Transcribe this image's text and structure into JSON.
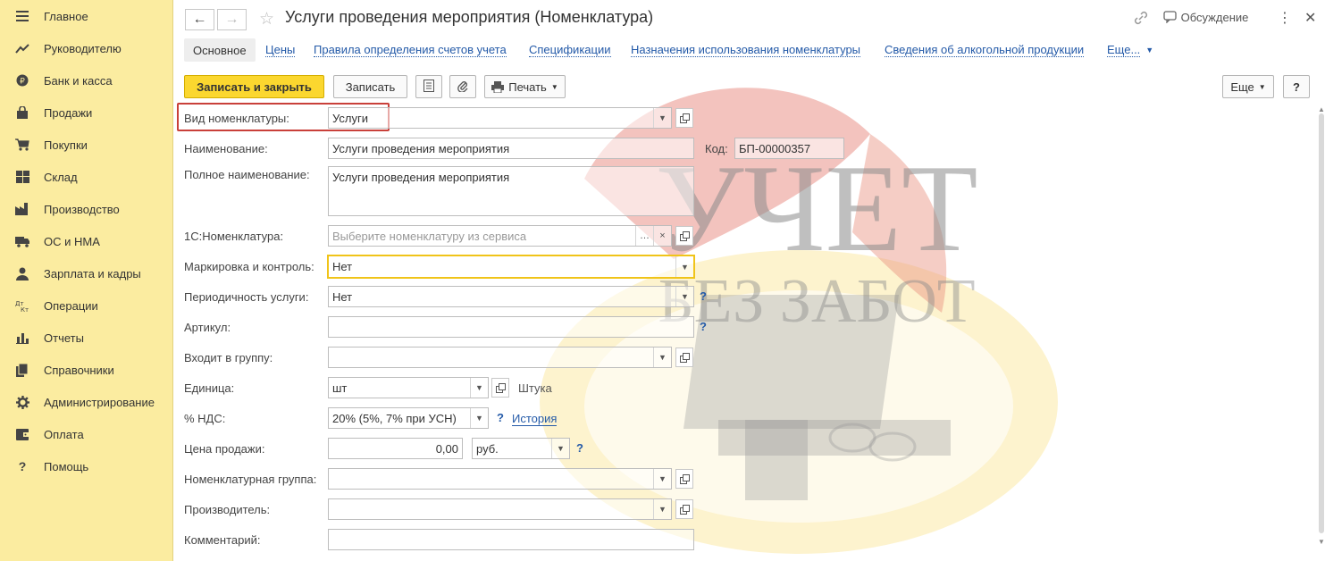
{
  "sidebar": {
    "items": [
      {
        "label": "Главное",
        "icon": "menu-icon"
      },
      {
        "label": "Руководителю",
        "icon": "trend-icon"
      },
      {
        "label": "Банк и касса",
        "icon": "coin-icon"
      },
      {
        "label": "Продажи",
        "icon": "bag-icon"
      },
      {
        "label": "Покупки",
        "icon": "cart-icon"
      },
      {
        "label": "Склад",
        "icon": "warehouse-icon"
      },
      {
        "label": "Производство",
        "icon": "factory-icon"
      },
      {
        "label": "ОС и НМА",
        "icon": "truck-icon"
      },
      {
        "label": "Зарплата и кадры",
        "icon": "person-icon"
      },
      {
        "label": "Операции",
        "icon": "dt-kt-icon"
      },
      {
        "label": "Отчеты",
        "icon": "bar-chart-icon"
      },
      {
        "label": "Справочники",
        "icon": "books-icon"
      },
      {
        "label": "Администрирование",
        "icon": "gear-icon"
      },
      {
        "label": "Оплата",
        "icon": "wallet-icon"
      },
      {
        "label": "Помощь",
        "icon": "question-icon"
      }
    ]
  },
  "header": {
    "title": "Услуги проведения мероприятия (Номенклатура)",
    "discussion_label": "Обсуждение"
  },
  "tabs": [
    {
      "label": "Основное"
    },
    {
      "label": "Цены"
    },
    {
      "label": "Правила определения счетов учета"
    },
    {
      "label": "Спецификации"
    },
    {
      "label": "Назначения использования номенклатуры"
    },
    {
      "label": "Сведения об алкогольной продукции"
    },
    {
      "label": "Еще..."
    }
  ],
  "toolbar": {
    "save_close_label": "Записать и закрыть",
    "save_label": "Записать",
    "print_label": "Печать",
    "more_label": "Еще",
    "help_label": "?"
  },
  "form": {
    "kind_label": "Вид номенклатуры:",
    "kind_value": "Услуги",
    "name_label": "Наименование:",
    "name_value": "Услуги проведения мероприятия",
    "code_label": "Код:",
    "code_value": "БП-00000357",
    "fullname_label": "Полное наименование:",
    "fullname_value": "Услуги проведения мероприятия",
    "nom1c_label": "1С:Номенклатура:",
    "nom1c_placeholder": "Выберите номенклатуру из сервиса",
    "marking_label": "Маркировка и контроль:",
    "marking_value": "Нет",
    "period_label": "Периодичность услуги:",
    "period_value": "Нет",
    "article_label": "Артикул:",
    "group_label": "Входит в группу:",
    "unit_label": "Единица:",
    "unit_value": "шт",
    "unit_hint": "Штука",
    "vat_label": "% НДС:",
    "vat_value": "20% (5%, 7% при УСН)",
    "vat_history": "История",
    "price_label": "Цена продажи:",
    "price_value": "0,00",
    "currency_value": "руб.",
    "nomgroup_label": "Номенклатурная группа:",
    "manufacturer_label": "Производитель:",
    "comment_label": "Комментарий:"
  },
  "watermark": {
    "line1": "УЧЕТ",
    "line2": "БЕЗ ЗАБОТ"
  }
}
